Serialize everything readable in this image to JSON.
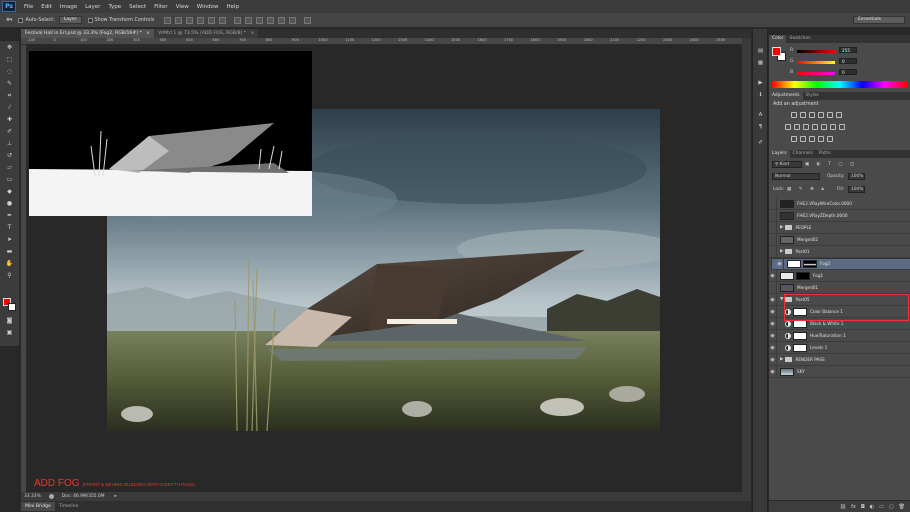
{
  "app": {
    "logo": "Ps"
  },
  "menu": [
    "File",
    "Edit",
    "Image",
    "Layer",
    "Type",
    "Select",
    "Filter",
    "View",
    "Window",
    "Help"
  ],
  "options": {
    "auto_select_label": "Auto-Select:",
    "auto_select_value": "Layer",
    "show_transform_label": "Show Transform Controls",
    "workspace": "Essentials"
  },
  "tabs": [
    {
      "label": "Festival Hall in Erl.psd @ 33.3% (Fog2, RGB/16#) *",
      "active": true,
      "close": "×"
    },
    {
      "label": "VrMtrl 1 @ 73.5% (ADD FOG, RGB/8) *",
      "active": false,
      "close": "×"
    }
  ],
  "ruler_ticks": [
    "-100",
    "0",
    "100",
    "200",
    "300",
    "400",
    "500",
    "600",
    "700",
    "800",
    "900",
    "1000",
    "1100",
    "1200",
    "1300",
    "1400",
    "1500",
    "1600",
    "1700",
    "1800",
    "1900",
    "2000",
    "2100",
    "2200",
    "2300",
    "2400",
    "2500"
  ],
  "caption": {
    "main": "ADD FOG",
    "sub": "(FRONT & BEHIND BUILDING WITH Z-DEPTH PASS)"
  },
  "status": {
    "zoom": "33.33%",
    "doc": "Doc: 46.9M/355.0M"
  },
  "bottom_tabs": [
    "Mini Bridge",
    "Timeline"
  ],
  "color_panel": {
    "tabs": [
      "Color",
      "Swatches"
    ],
    "channels": [
      {
        "label": "R",
        "value": "255",
        "color": "#e53030"
      },
      {
        "label": "G",
        "value": "0",
        "color": "#30c030"
      },
      {
        "label": "B",
        "value": "0",
        "color": "#3050e0"
      }
    ],
    "foreground": "#ff0000",
    "background": "#ffffff"
  },
  "adjustments_panel": {
    "tabs": [
      "Adjustments",
      "Styles"
    ],
    "heading": "Add an adjustment"
  },
  "layers_panel": {
    "tabs": [
      "Layers",
      "Channels",
      "Paths"
    ],
    "filter_kind": "Kind",
    "blend_mode": "Normal",
    "opacity_label": "Opacity:",
    "opacity": "100%",
    "lock_label": "Lock:",
    "fill_label": "Fill:",
    "fill": "100%",
    "layers": [
      {
        "name": "FHE2.VRayWireColor.0000",
        "visible": false,
        "kind": "pixel",
        "thumb": "#222"
      },
      {
        "name": "FHE2.VRayZDepth.0000",
        "visible": false,
        "kind": "pixel",
        "thumb": "#333"
      },
      {
        "name": "PEOPLE",
        "visible": false,
        "kind": "group"
      },
      {
        "name": "Merged02",
        "visible": false,
        "kind": "pixel",
        "thumb": "#666"
      },
      {
        "name": "Post01",
        "visible": false,
        "kind": "group"
      },
      {
        "name": "Fog2",
        "visible": true,
        "kind": "masked",
        "thumb": "#ffffff",
        "selected": true
      },
      {
        "name": "Fog1",
        "visible": true,
        "kind": "masked",
        "thumb": "#e8e8e8"
      },
      {
        "name": "Merged01",
        "visible": false,
        "kind": "pixel",
        "thumb": "#556"
      },
      {
        "name": "Post05",
        "visible": true,
        "kind": "group-open"
      },
      {
        "name": "Color Balance 1",
        "visible": true,
        "kind": "adjustment"
      },
      {
        "name": "Black & White 1",
        "visible": true,
        "kind": "adjustment"
      },
      {
        "name": "Hue/Saturation 1",
        "visible": true,
        "kind": "adjustment"
      },
      {
        "name": "Levels 1",
        "visible": true,
        "kind": "adjustment"
      },
      {
        "name": "RENDER PASS",
        "visible": true,
        "kind": "group"
      },
      {
        "name": "SKY",
        "visible": true,
        "kind": "pixel",
        "thumb": "#7d8f99"
      }
    ],
    "footer_icons": [
      "link-icon",
      "fx-icon",
      "mask-icon",
      "adjustment-icon",
      "folder-icon",
      "new-layer-icon",
      "trash-icon"
    ]
  }
}
